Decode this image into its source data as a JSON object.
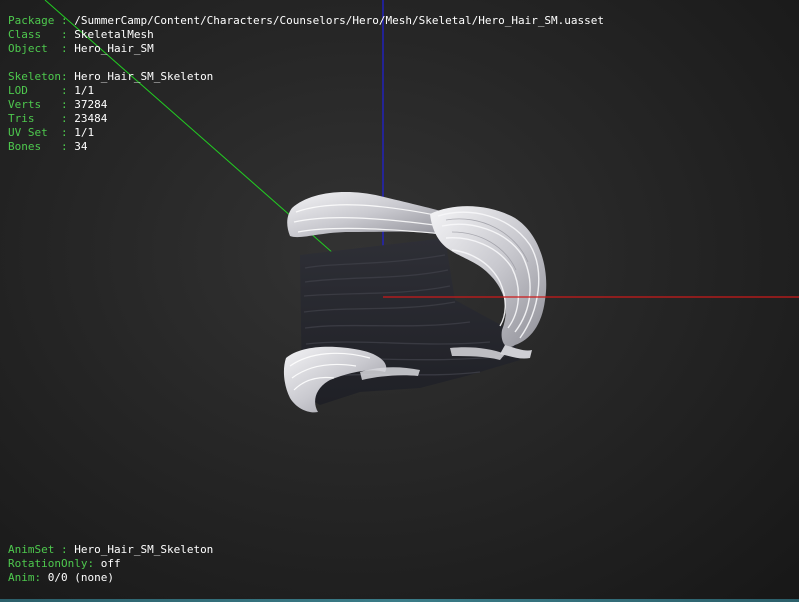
{
  "colors": {
    "label": "#4ec94e",
    "value": "#ffffff",
    "axis_x": "#cc1a1a",
    "axis_y": "#22cc22",
    "axis_z": "#2020dd"
  },
  "info_top": [
    {
      "key": "Package ",
      "sep": ": ",
      "value": "/SummerCamp/Content/Characters/Counselors/Hero/Mesh/Skeletal/Hero_Hair_SM.uasset"
    },
    {
      "key": "Class   ",
      "sep": ": ",
      "value": "SkeletalMesh"
    },
    {
      "key": "Object  ",
      "sep": ": ",
      "value": "Hero_Hair_SM"
    },
    {
      "key": "",
      "sep": "",
      "value": ""
    },
    {
      "key": "Skeleton",
      "sep": ": ",
      "value": "Hero_Hair_SM_Skeleton"
    },
    {
      "key": "LOD     ",
      "sep": ": ",
      "value": "1/1"
    },
    {
      "key": "Verts   ",
      "sep": ": ",
      "value": "37284"
    },
    {
      "key": "Tris    ",
      "sep": ": ",
      "value": "23484"
    },
    {
      "key": "UV Set  ",
      "sep": ": ",
      "value": "1/1"
    },
    {
      "key": "Bones   ",
      "sep": ": ",
      "value": "34"
    }
  ],
  "info_bottom": [
    {
      "key": "AnimSet ",
      "sep": ": ",
      "value": "Hero_Hair_SM_Skeleton"
    },
    {
      "key": "RotationOnly",
      "sep": ": ",
      "value": "off"
    },
    {
      "key": "Anim",
      "sep": ": ",
      "value": "0/0 (none)"
    }
  ]
}
